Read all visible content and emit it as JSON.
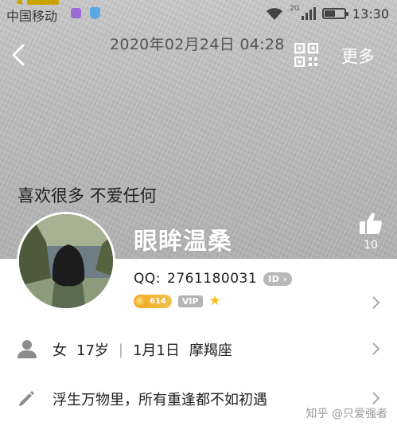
{
  "status_bar": {
    "carrier": "中国移动",
    "network": "2G",
    "time": "13:30",
    "battery_level": 0.55
  },
  "header": {
    "date": "2020年02月24日 04:28",
    "more_label": "更多"
  },
  "profile": {
    "signature": "喜欢很多 不爱任何",
    "nickname": "眼眸温桑",
    "like_count": "10",
    "qq_label": "QQ:",
    "qq_number": "2761180031",
    "id_badge": "ID",
    "level": "614",
    "vip_label": "VIP"
  },
  "info_row": {
    "gender": "女",
    "age": "17岁",
    "birthday": "1月1日",
    "zodiac": "摩羯座"
  },
  "desc_row": {
    "text": "浮生万物里，所有重逢都不如初遇"
  },
  "watermark": "知乎 @只爱强者",
  "colors": {
    "cover": "#bfbfbf",
    "level_badge": "#f6a623",
    "star": "#f2c21a"
  }
}
